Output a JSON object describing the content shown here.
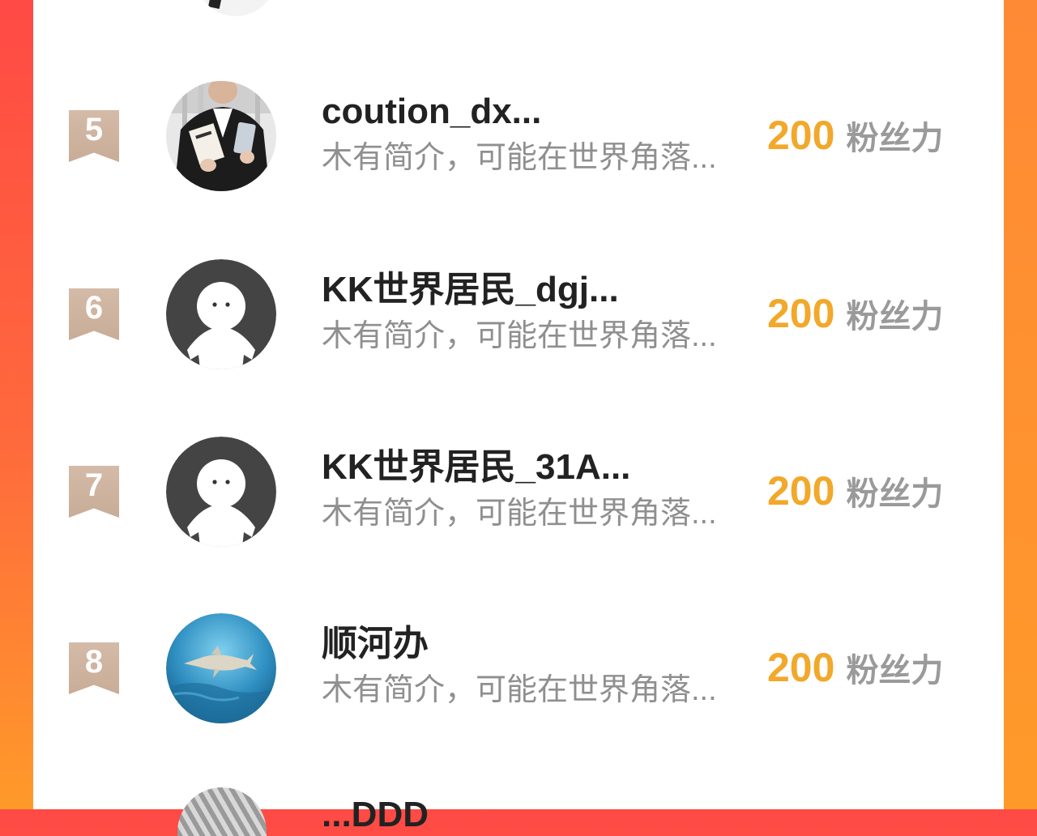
{
  "rows": [
    {
      "rank": "5",
      "name": "coution_dx...",
      "desc": "木有简介，可能在世界角落...",
      "score": "200",
      "unit": "粉丝力"
    },
    {
      "rank": "6",
      "name": "KK世界居民_dgj...",
      "desc": "木有简介，可能在世界角落...",
      "score": "200",
      "unit": "粉丝力"
    },
    {
      "rank": "7",
      "name": "KK世界居民_31A...",
      "desc": "木有简介，可能在世界角落...",
      "score": "200",
      "unit": "粉丝力"
    },
    {
      "rank": "8",
      "name": "顺河办",
      "desc": "木有简介，可能在世界角落...",
      "score": "200",
      "unit": "粉丝力"
    }
  ],
  "partial_bottom": {
    "name": "...DDD"
  },
  "colors": {
    "accent_score": "#f2a82a",
    "rank_flag": "#c8ac96",
    "bg_gradient_top": "#ff4a45",
    "bg_gradient_bottom": "#ff9a2a"
  }
}
